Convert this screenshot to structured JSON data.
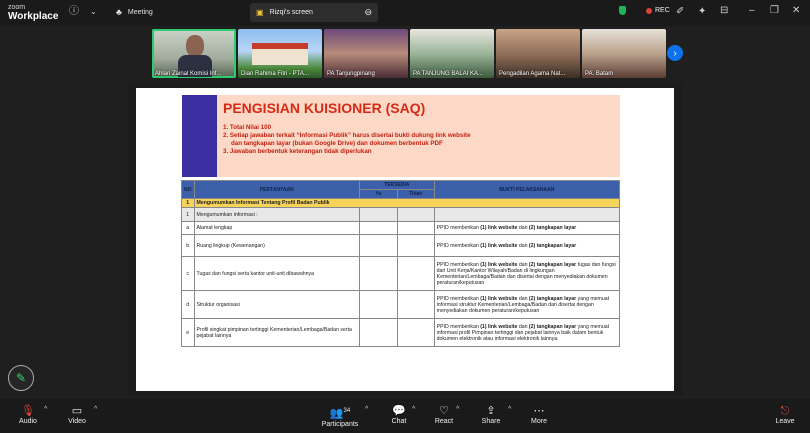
{
  "app": {
    "brand_top": "zoom",
    "brand_bottom": "Workplace"
  },
  "topbar": {
    "meeting_label": "Meeting",
    "share_label": "Rizqi's screen",
    "rec_label": "REC"
  },
  "participants_strip": [
    {
      "name": "Ahlan Zainal Komisi Inf..."
    },
    {
      "name": "Dian Rahima Fitri - PTA..."
    },
    {
      "name": "PA Tanjungpinang"
    },
    {
      "name": "PA TANJUNG BALAI KA..."
    },
    {
      "name": "Pengadilan Agama Nat..."
    },
    {
      "name": "PA. Batam"
    }
  ],
  "document": {
    "title": "PENGISIAN KUISIONER (SAQ)",
    "notes": [
      "1. Total Nilai 100",
      "2. Setiap jawaban terkait “Informasi Publik” harus disertai bukti dukung link website",
      "dan tangkapan layar (bukan Google Drive) dan dokumen berbentuk PDF",
      "3. Jawaban berbentuk keterangan tidak diperlukan"
    ],
    "table": {
      "h_no": "NO",
      "h_q": "PERTANYAAN",
      "h_avail": "TERSEDIA",
      "h_ya": "Ya",
      "h_tidak": "Tidak",
      "h_evidence": "BUKTI PELAKSANAAN",
      "section_no": "1",
      "section_label": "Mengumumkan Informasi Tentang Profil Badan Publik",
      "sub_no": "1",
      "sub_label": "Mengumumkan informasi :",
      "rows": [
        {
          "no": "a",
          "q": "Alamat lengkap",
          "e1": "PPID memberikan ",
          "e2": "(1) link website",
          "e3": " dan ",
          "e4": "(2) tangkapan layar",
          "e5": ""
        },
        {
          "no": "b",
          "q": "Ruang lingkup (Kewenangan)",
          "e1": "PPID memberikan ",
          "e2": "(1) link website",
          "e3": " dan ",
          "e4": "(2) tangkapan layar",
          "e5": ""
        },
        {
          "no": "c",
          "q": "Tugas dan fungsi serta kantor unit-unit dibawahnya",
          "e1": "PPID memberikan ",
          "e2": "(1) link website",
          "e3": " dan ",
          "e4": "(2) tangkapan layar",
          "e5": " tugas dan fungsi dari Unit Kerja/Kantor Wilayah/Badan di lingkungan Kementerian/Lembaga/Badan dan disertai dengan menyediakan dokumen peraturan/keputusan"
        },
        {
          "no": "d",
          "q": "Struktur organisasi",
          "e1": "PPID memberikan ",
          "e2": "(1) link website",
          "e3": " dan ",
          "e4": "(2) tangkapan layar",
          "e5": " yang memuat informasi struktur Kementerian/Lembaga/Badan dan disertai dengan menyediakan dokumen peraturan/keputusan"
        },
        {
          "no": "e",
          "q": "Profil singkat pimpinan tertinggi Kementerian/Lembaga/Badan serta pejabat lainnya",
          "e1": "PPID memberikan ",
          "e2": "(1) link website",
          "e3": " dan ",
          "e4": "(2) tangkapan layar",
          "e5": " yang memuat informasi profil Pimpinan tertinggi dan pejabat lainnya baik dalam bentuk dokumen elektronik atau informasi elektronik lainnya."
        }
      ]
    }
  },
  "toolbar": {
    "audio": "Audio",
    "video": "Video",
    "participants": "Participants",
    "participants_count": "34",
    "chat": "Chat",
    "react": "React",
    "share": "Share",
    "more": "More",
    "leave": "Leave"
  },
  "colors": {
    "accent": "#0e72ed",
    "active_speaker": "#2dcc70",
    "leave": "#e74b3c",
    "doc_title": "#d62a16"
  }
}
